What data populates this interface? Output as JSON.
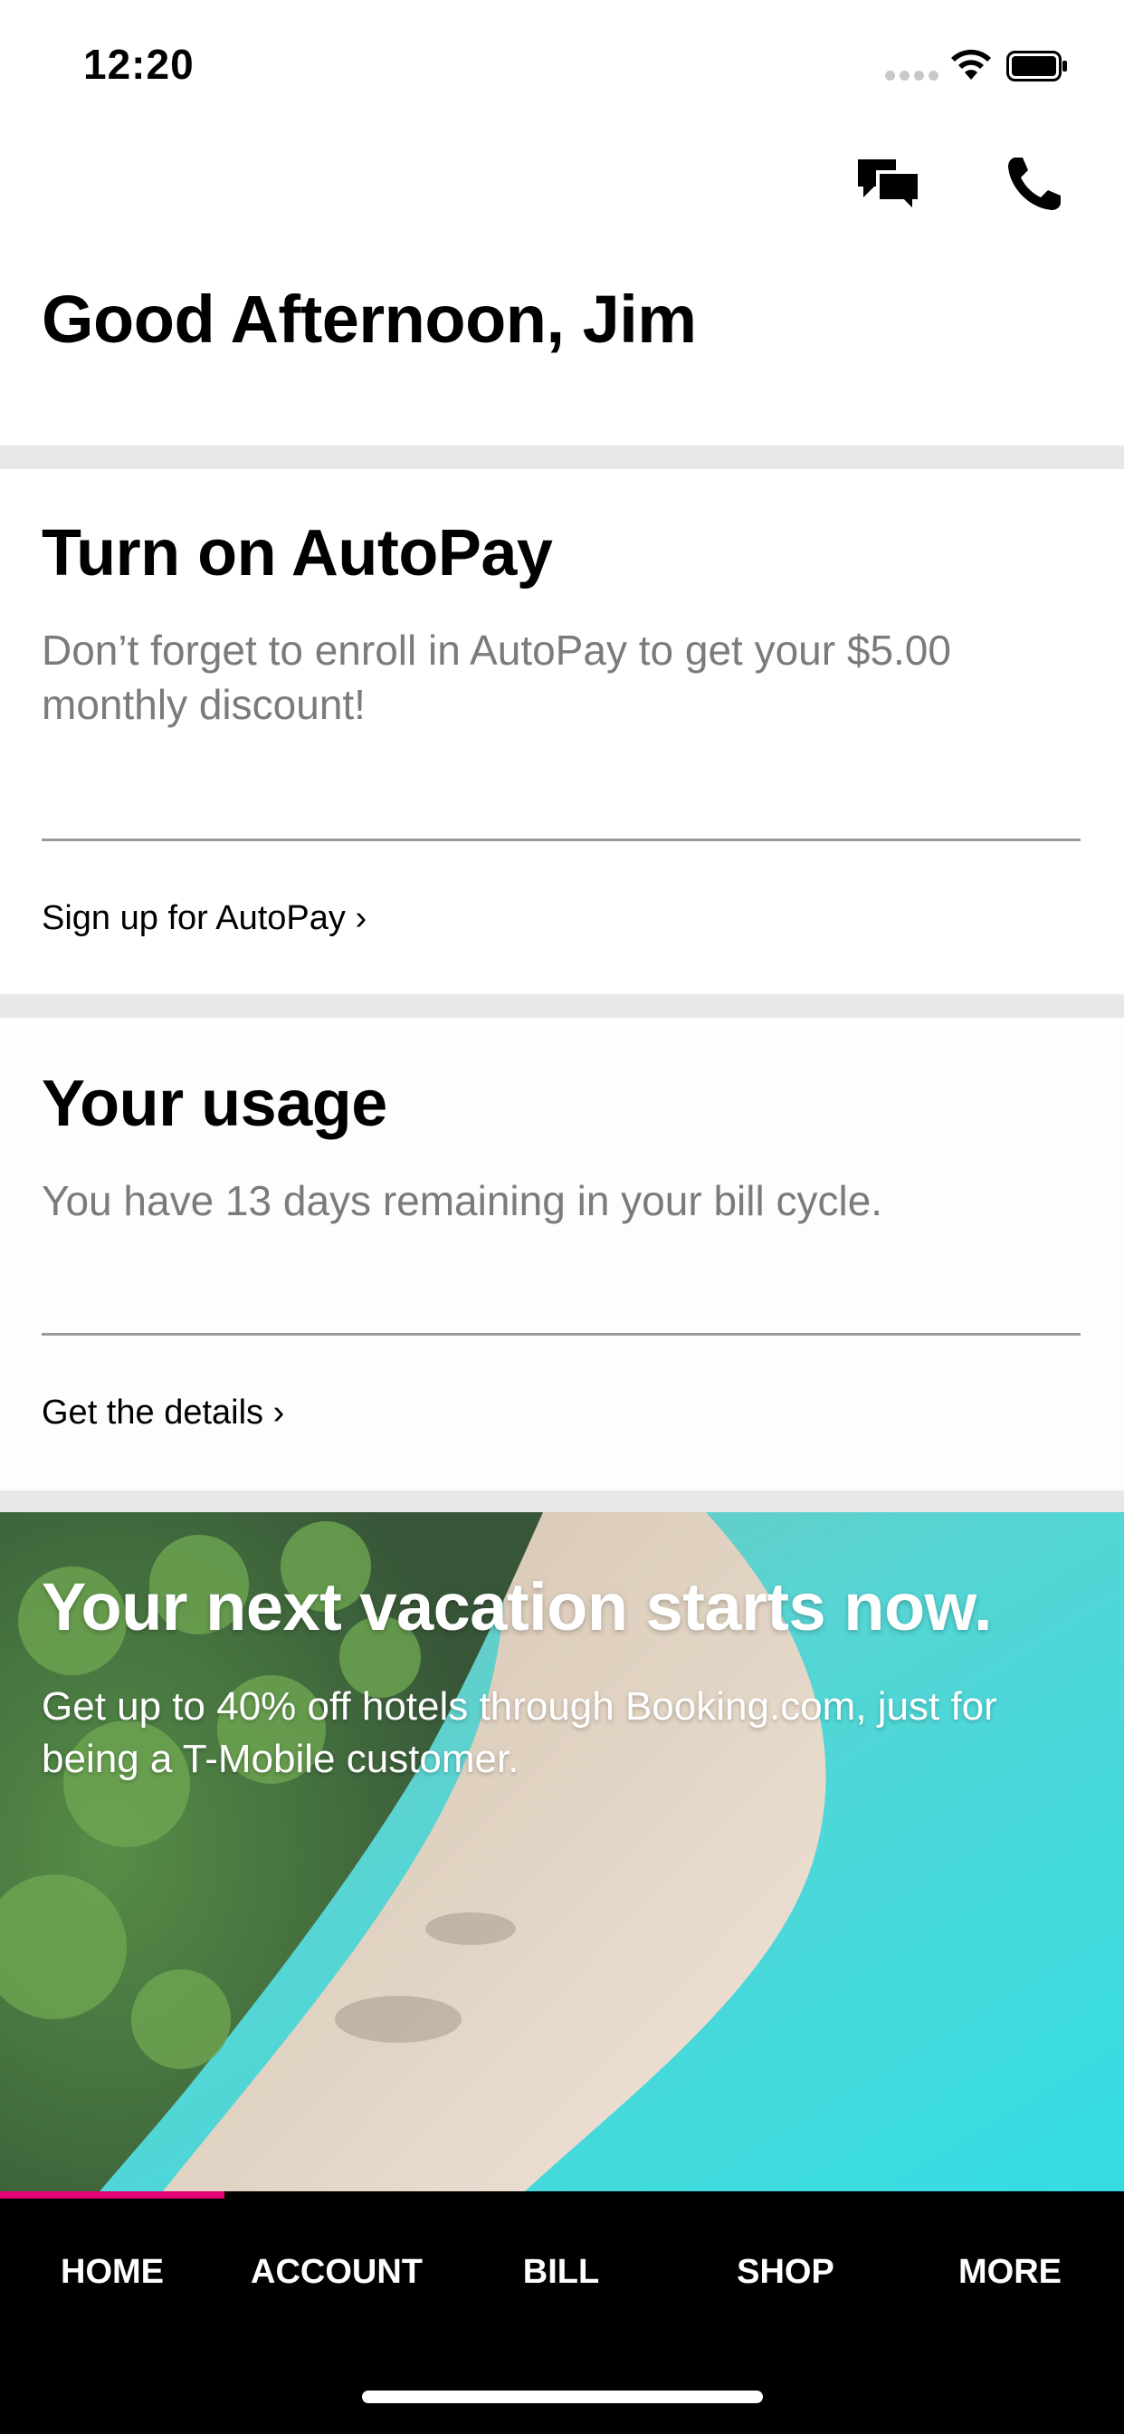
{
  "status_bar": {
    "time": "12:20"
  },
  "header": {
    "greeting": "Good Afternoon, Jim"
  },
  "autopay_card": {
    "title": "Turn on AutoPay",
    "body": "Don’t forget to enroll in AutoPay to get your $5.00 monthly discount!",
    "link": "Sign up for AutoPay ›"
  },
  "usage_card": {
    "title": "Your usage",
    "body": "You have 13 days remaining in your bill cycle.",
    "link": "Get the details ›"
  },
  "promo": {
    "title": "Your next vacation starts now.",
    "subtitle": "Get up to 40% off hotels through Booking.com, just for being a T-Mobile customer."
  },
  "tabs": [
    {
      "label": "HOME",
      "selected": true
    },
    {
      "label": "ACCOUNT",
      "selected": false
    },
    {
      "label": "BILL",
      "selected": false
    },
    {
      "label": "SHOP",
      "selected": false
    },
    {
      "label": "MORE",
      "selected": false
    }
  ],
  "colors": {
    "accent": "#e20074",
    "tab_bar": "#000000",
    "body_text": "#7b7b7b"
  },
  "icons": [
    "wifi-icon",
    "battery-icon",
    "chat-icon",
    "phone-icon"
  ]
}
